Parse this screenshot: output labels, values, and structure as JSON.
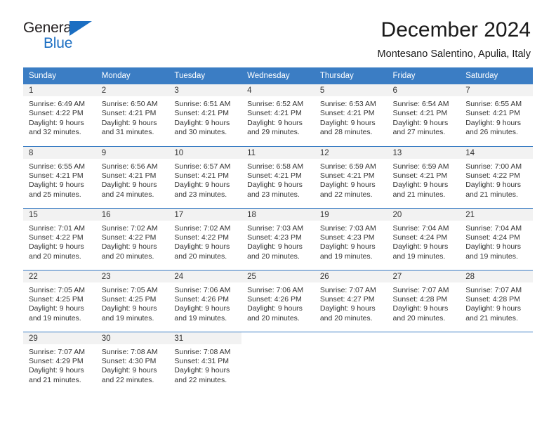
{
  "brand": {
    "name_part1": "General",
    "name_part2": "Blue",
    "logo_icon": "triangle-logo-icon",
    "accent_color": "#1b6ec2"
  },
  "header": {
    "title": "December 2024",
    "subtitle": "Montesano Salentino, Apulia, Italy"
  },
  "calendar": {
    "header_bg": "#3b7dc4",
    "daynum_bg": "#f2f2f2",
    "weekdays": [
      "Sunday",
      "Monday",
      "Tuesday",
      "Wednesday",
      "Thursday",
      "Friday",
      "Saturday"
    ],
    "weeks": [
      [
        {
          "day": "1",
          "sunrise": "Sunrise: 6:49 AM",
          "sunset": "Sunset: 4:22 PM",
          "daylight_line1": "Daylight: 9 hours",
          "daylight_line2": "and 32 minutes."
        },
        {
          "day": "2",
          "sunrise": "Sunrise: 6:50 AM",
          "sunset": "Sunset: 4:21 PM",
          "daylight_line1": "Daylight: 9 hours",
          "daylight_line2": "and 31 minutes."
        },
        {
          "day": "3",
          "sunrise": "Sunrise: 6:51 AM",
          "sunset": "Sunset: 4:21 PM",
          "daylight_line1": "Daylight: 9 hours",
          "daylight_line2": "and 30 minutes."
        },
        {
          "day": "4",
          "sunrise": "Sunrise: 6:52 AM",
          "sunset": "Sunset: 4:21 PM",
          "daylight_line1": "Daylight: 9 hours",
          "daylight_line2": "and 29 minutes."
        },
        {
          "day": "5",
          "sunrise": "Sunrise: 6:53 AM",
          "sunset": "Sunset: 4:21 PM",
          "daylight_line1": "Daylight: 9 hours",
          "daylight_line2": "and 28 minutes."
        },
        {
          "day": "6",
          "sunrise": "Sunrise: 6:54 AM",
          "sunset": "Sunset: 4:21 PM",
          "daylight_line1": "Daylight: 9 hours",
          "daylight_line2": "and 27 minutes."
        },
        {
          "day": "7",
          "sunrise": "Sunrise: 6:55 AM",
          "sunset": "Sunset: 4:21 PM",
          "daylight_line1": "Daylight: 9 hours",
          "daylight_line2": "and 26 minutes."
        }
      ],
      [
        {
          "day": "8",
          "sunrise": "Sunrise: 6:55 AM",
          "sunset": "Sunset: 4:21 PM",
          "daylight_line1": "Daylight: 9 hours",
          "daylight_line2": "and 25 minutes."
        },
        {
          "day": "9",
          "sunrise": "Sunrise: 6:56 AM",
          "sunset": "Sunset: 4:21 PM",
          "daylight_line1": "Daylight: 9 hours",
          "daylight_line2": "and 24 minutes."
        },
        {
          "day": "10",
          "sunrise": "Sunrise: 6:57 AM",
          "sunset": "Sunset: 4:21 PM",
          "daylight_line1": "Daylight: 9 hours",
          "daylight_line2": "and 23 minutes."
        },
        {
          "day": "11",
          "sunrise": "Sunrise: 6:58 AM",
          "sunset": "Sunset: 4:21 PM",
          "daylight_line1": "Daylight: 9 hours",
          "daylight_line2": "and 23 minutes."
        },
        {
          "day": "12",
          "sunrise": "Sunrise: 6:59 AM",
          "sunset": "Sunset: 4:21 PM",
          "daylight_line1": "Daylight: 9 hours",
          "daylight_line2": "and 22 minutes."
        },
        {
          "day": "13",
          "sunrise": "Sunrise: 6:59 AM",
          "sunset": "Sunset: 4:21 PM",
          "daylight_line1": "Daylight: 9 hours",
          "daylight_line2": "and 21 minutes."
        },
        {
          "day": "14",
          "sunrise": "Sunrise: 7:00 AM",
          "sunset": "Sunset: 4:22 PM",
          "daylight_line1": "Daylight: 9 hours",
          "daylight_line2": "and 21 minutes."
        }
      ],
      [
        {
          "day": "15",
          "sunrise": "Sunrise: 7:01 AM",
          "sunset": "Sunset: 4:22 PM",
          "daylight_line1": "Daylight: 9 hours",
          "daylight_line2": "and 20 minutes."
        },
        {
          "day": "16",
          "sunrise": "Sunrise: 7:02 AM",
          "sunset": "Sunset: 4:22 PM",
          "daylight_line1": "Daylight: 9 hours",
          "daylight_line2": "and 20 minutes."
        },
        {
          "day": "17",
          "sunrise": "Sunrise: 7:02 AM",
          "sunset": "Sunset: 4:22 PM",
          "daylight_line1": "Daylight: 9 hours",
          "daylight_line2": "and 20 minutes."
        },
        {
          "day": "18",
          "sunrise": "Sunrise: 7:03 AM",
          "sunset": "Sunset: 4:23 PM",
          "daylight_line1": "Daylight: 9 hours",
          "daylight_line2": "and 20 minutes."
        },
        {
          "day": "19",
          "sunrise": "Sunrise: 7:03 AM",
          "sunset": "Sunset: 4:23 PM",
          "daylight_line1": "Daylight: 9 hours",
          "daylight_line2": "and 19 minutes."
        },
        {
          "day": "20",
          "sunrise": "Sunrise: 7:04 AM",
          "sunset": "Sunset: 4:24 PM",
          "daylight_line1": "Daylight: 9 hours",
          "daylight_line2": "and 19 minutes."
        },
        {
          "day": "21",
          "sunrise": "Sunrise: 7:04 AM",
          "sunset": "Sunset: 4:24 PM",
          "daylight_line1": "Daylight: 9 hours",
          "daylight_line2": "and 19 minutes."
        }
      ],
      [
        {
          "day": "22",
          "sunrise": "Sunrise: 7:05 AM",
          "sunset": "Sunset: 4:25 PM",
          "daylight_line1": "Daylight: 9 hours",
          "daylight_line2": "and 19 minutes."
        },
        {
          "day": "23",
          "sunrise": "Sunrise: 7:05 AM",
          "sunset": "Sunset: 4:25 PM",
          "daylight_line1": "Daylight: 9 hours",
          "daylight_line2": "and 19 minutes."
        },
        {
          "day": "24",
          "sunrise": "Sunrise: 7:06 AM",
          "sunset": "Sunset: 4:26 PM",
          "daylight_line1": "Daylight: 9 hours",
          "daylight_line2": "and 19 minutes."
        },
        {
          "day": "25",
          "sunrise": "Sunrise: 7:06 AM",
          "sunset": "Sunset: 4:26 PM",
          "daylight_line1": "Daylight: 9 hours",
          "daylight_line2": "and 20 minutes."
        },
        {
          "day": "26",
          "sunrise": "Sunrise: 7:07 AM",
          "sunset": "Sunset: 4:27 PM",
          "daylight_line1": "Daylight: 9 hours",
          "daylight_line2": "and 20 minutes."
        },
        {
          "day": "27",
          "sunrise": "Sunrise: 7:07 AM",
          "sunset": "Sunset: 4:28 PM",
          "daylight_line1": "Daylight: 9 hours",
          "daylight_line2": "and 20 minutes."
        },
        {
          "day": "28",
          "sunrise": "Sunrise: 7:07 AM",
          "sunset": "Sunset: 4:28 PM",
          "daylight_line1": "Daylight: 9 hours",
          "daylight_line2": "and 21 minutes."
        }
      ],
      [
        {
          "day": "29",
          "sunrise": "Sunrise: 7:07 AM",
          "sunset": "Sunset: 4:29 PM",
          "daylight_line1": "Daylight: 9 hours",
          "daylight_line2": "and 21 minutes."
        },
        {
          "day": "30",
          "sunrise": "Sunrise: 7:08 AM",
          "sunset": "Sunset: 4:30 PM",
          "daylight_line1": "Daylight: 9 hours",
          "daylight_line2": "and 22 minutes."
        },
        {
          "day": "31",
          "sunrise": "Sunrise: 7:08 AM",
          "sunset": "Sunset: 4:31 PM",
          "daylight_line1": "Daylight: 9 hours",
          "daylight_line2": "and 22 minutes."
        },
        {
          "day": "",
          "sunrise": "",
          "sunset": "",
          "daylight_line1": "",
          "daylight_line2": ""
        },
        {
          "day": "",
          "sunrise": "",
          "sunset": "",
          "daylight_line1": "",
          "daylight_line2": ""
        },
        {
          "day": "",
          "sunrise": "",
          "sunset": "",
          "daylight_line1": "",
          "daylight_line2": ""
        },
        {
          "day": "",
          "sunrise": "",
          "sunset": "",
          "daylight_line1": "",
          "daylight_line2": ""
        }
      ]
    ]
  }
}
